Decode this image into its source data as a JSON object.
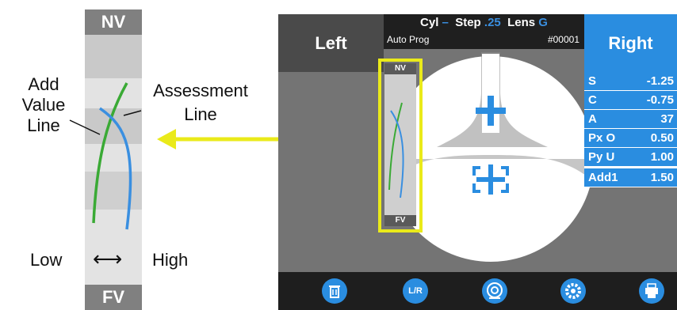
{
  "diagram": {
    "top_label": "NV",
    "bottom_label": "FV",
    "add_value_line_label_lines": [
      "Add",
      "Value",
      "Line"
    ],
    "assessment_line_label_lines": [
      "Assessment",
      "Line"
    ],
    "low_label": "Low",
    "arrow_symbol": "⟷",
    "high_label": "High"
  },
  "device": {
    "left_button": "Left",
    "right_button": "Right",
    "header": {
      "cyl_label": "Cyl",
      "cyl_dash": "–",
      "step_label": "Step",
      "step_value": ".25",
      "lens_label": "Lens",
      "lens_value": "G",
      "mode": "Auto Prog",
      "record": "#00001"
    },
    "mini_top": "NV",
    "mini_bottom": "FV",
    "params": [
      {
        "key": "S",
        "value": "-1.25"
      },
      {
        "key": "C",
        "value": "-0.75"
      },
      {
        "key": "A",
        "value": "37"
      },
      {
        "key": "Px O",
        "value": "0.50"
      },
      {
        "key": "Py U",
        "value": "1.00"
      }
    ],
    "add": {
      "key": "Add1",
      "value": "1.50"
    },
    "toolbar_icons": [
      "trash-icon",
      "lr-icon",
      "lens-icon",
      "gear-icon",
      "printer-icon"
    ],
    "lr_text": "L/R"
  },
  "colors": {
    "accent_blue": "#2a8de0",
    "highlight_yellow": "#eaea1a",
    "add_line_green": "#3aaa35",
    "assessment_line_blue": "#3a8fe0"
  }
}
